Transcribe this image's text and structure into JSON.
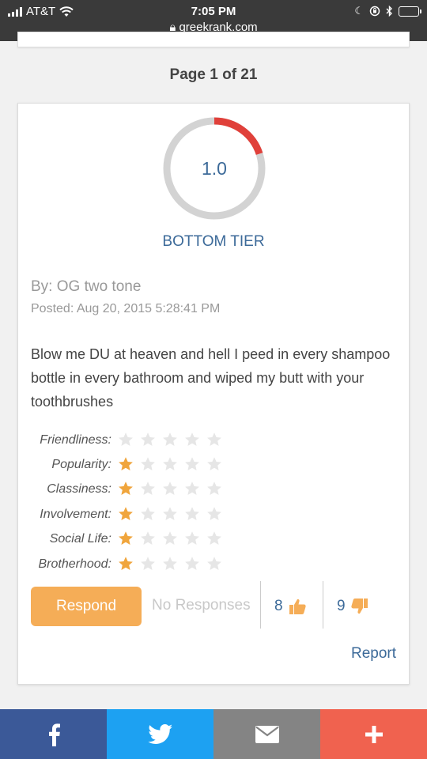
{
  "status_bar": {
    "carrier": "AT&T",
    "time": "7:05 PM",
    "url": "greekrank.com",
    "icons": [
      "signal-icon",
      "wifi-icon",
      "moon-icon",
      "rotation-lock-icon",
      "bluetooth-icon",
      "battery-icon"
    ],
    "battery_level": 0.25
  },
  "pagination": {
    "label": "Page 1 of 21"
  },
  "review": {
    "score": "1.0",
    "score_fraction": 0.2,
    "gauge_color": "#e0403a",
    "tier": "BOTTOM TIER",
    "author": "By: OG two tone",
    "posted": "Posted: Aug 20, 2015 5:28:41 PM",
    "body": "Blow me DU at heaven and hell I peed in every shampoo bottle in every bathroom and wiped my butt with your toothbrushes",
    "ratings": [
      {
        "label": "Friendliness:",
        "stars": 0
      },
      {
        "label": "Popularity:",
        "stars": 1
      },
      {
        "label": "Classiness:",
        "stars": 1
      },
      {
        "label": "Involvement:",
        "stars": 1
      },
      {
        "label": "Social Life:",
        "stars": 1
      },
      {
        "label": "Brotherhood:",
        "stars": 1
      }
    ],
    "max_stars": 5,
    "respond_label": "Respond",
    "responses_label": "No Responses",
    "upvotes": "8",
    "downvotes": "9",
    "report_label": "Report"
  },
  "share_bar": [
    {
      "name": "facebook",
      "icon": "facebook-icon",
      "color": "#3b5998"
    },
    {
      "name": "twitter",
      "icon": "twitter-icon",
      "color": "#1da1f2"
    },
    {
      "name": "email",
      "icon": "mail-icon",
      "color": "#848484"
    },
    {
      "name": "more",
      "icon": "plus-icon",
      "color": "#f0624f"
    }
  ],
  "colors": {
    "accent": "#3c6a99",
    "star_filled": "#f0a53c",
    "star_empty": "#e6e6e6",
    "respond_button": "#f5ad57"
  }
}
